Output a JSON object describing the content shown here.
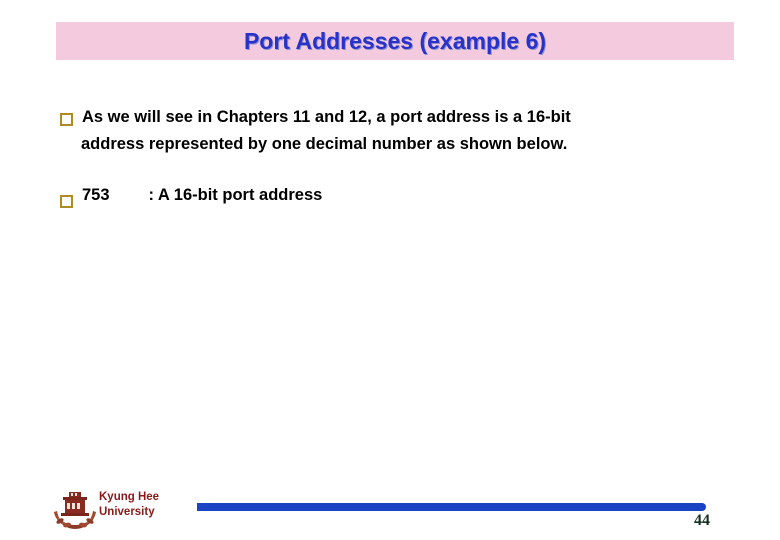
{
  "slide": {
    "title": "Port Addresses (example 6)",
    "title_band_color": "#f4cade",
    "title_text_color": "#2832cb",
    "background_color": "#ffffff"
  },
  "body": {
    "bullet_marker_color": "#b08a22",
    "bullets": [
      {
        "marker": "hollow-square-bullet",
        "line1": "As we will see in Chapters 11 and 12, a port address is a 16-bit",
        "line2": "address represented by one decimal number as shown below."
      },
      {
        "marker": "hollow-square-bullet",
        "value": "753",
        "description": ": A 16-bit port address"
      }
    ]
  },
  "footer": {
    "logo": "kyung-hee-university-crest",
    "university_line1": "Kyung Hee",
    "university_line2": "University",
    "university_color": "#8b1a1a",
    "bar_color": "#1b43c4",
    "page_number": "44"
  }
}
